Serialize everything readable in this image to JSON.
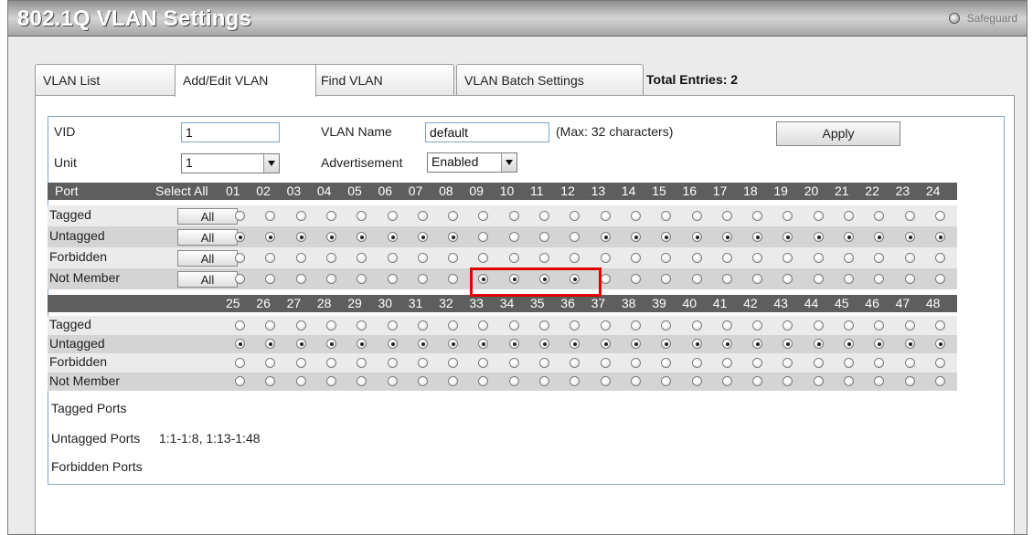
{
  "window": {
    "title": "802.1Q VLAN Settings",
    "safeguard_label": "Safeguard"
  },
  "tabs": [
    {
      "label": "VLAN List"
    },
    {
      "label": "Add/Edit VLAN"
    },
    {
      "label": "Find VLAN"
    },
    {
      "label": "VLAN Batch Settings"
    }
  ],
  "total_entries": "Total Entries: 2",
  "form": {
    "vid_label": "VID",
    "vid_value": "1",
    "vlan_name_label": "VLAN Name",
    "vlan_name_value": "default",
    "max_hint": "(Max: 32 characters)",
    "apply_label": "Apply",
    "unit_label": "Unit",
    "unit_value": "1",
    "advertisement_label": "Advertisement",
    "advertisement_value": "Enabled"
  },
  "port_table": {
    "port_header": "Port",
    "select_all_header": "Select All",
    "all_label": "All",
    "row_labels": [
      "Tagged",
      "Untagged",
      "Forbidden",
      "Not Member"
    ],
    "ports_block1": [
      "01",
      "02",
      "03",
      "04",
      "05",
      "06",
      "07",
      "08",
      "09",
      "10",
      "11",
      "12",
      "13",
      "14",
      "15",
      "16",
      "17",
      "18",
      "19",
      "20",
      "21",
      "22",
      "23",
      "24"
    ],
    "ports_block2": [
      "25",
      "26",
      "27",
      "28",
      "29",
      "30",
      "31",
      "32",
      "33",
      "34",
      "35",
      "36",
      "37",
      "38",
      "39",
      "40",
      "41",
      "42",
      "43",
      "44",
      "45",
      "46",
      "47",
      "48"
    ],
    "selection_block1": [
      "Untagged",
      "Untagged",
      "Untagged",
      "Untagged",
      "Untagged",
      "Untagged",
      "Untagged",
      "Untagged",
      "Not Member",
      "Not Member",
      "Not Member",
      "Not Member",
      "Untagged",
      "Untagged",
      "Untagged",
      "Untagged",
      "Untagged",
      "Untagged",
      "Untagged",
      "Untagged",
      "Untagged",
      "Untagged",
      "Untagged",
      "Untagged"
    ],
    "selection_block2": [
      "Untagged",
      "Untagged",
      "Untagged",
      "Untagged",
      "Untagged",
      "Untagged",
      "Untagged",
      "Untagged",
      "Untagged",
      "Untagged",
      "Untagged",
      "Untagged",
      "Untagged",
      "Untagged",
      "Untagged",
      "Untagged",
      "Untagged",
      "Untagged",
      "Untagged",
      "Untagged",
      "Untagged",
      "Untagged",
      "Untagged",
      "Untagged"
    ]
  },
  "summary": {
    "tagged_label": "Tagged Ports",
    "tagged_value": "",
    "untagged_label": "Untagged Ports",
    "untagged_value": "1:1-1:8, 1:13-1:48",
    "forbidden_label": "Forbidden Ports",
    "forbidden_value": ""
  },
  "colors": {
    "highlight": "#e00000",
    "header_bg": "#5e5e5e",
    "row_shade": "#d4d4d4",
    "field_border": "#7fa6c9"
  }
}
